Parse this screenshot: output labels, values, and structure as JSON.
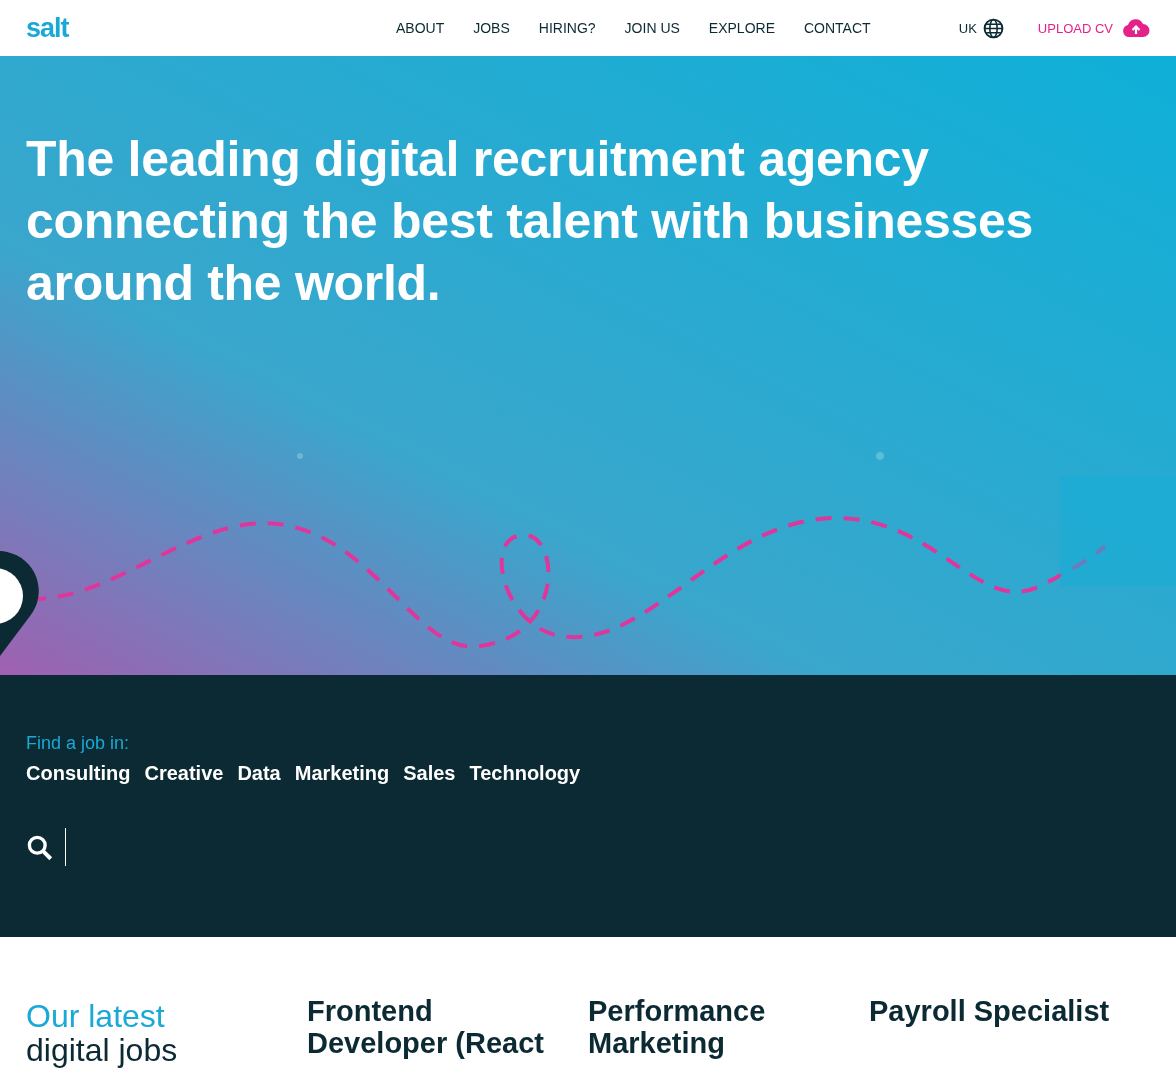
{
  "header": {
    "logo": "salt",
    "nav": [
      {
        "label": "ABOUT"
      },
      {
        "label": "JOBS"
      },
      {
        "label": "HIRING?"
      },
      {
        "label": "JOIN US"
      },
      {
        "label": "EXPLORE"
      },
      {
        "label": "CONTACT"
      }
    ],
    "region": "UK",
    "upload": "UPLOAD CV"
  },
  "hero": {
    "headline": "The leading digital recruitment agency connecting the best talent with businesses around the world."
  },
  "search_section": {
    "label": "Find a job in:",
    "categories": [
      "Consulting",
      "Creative",
      "Data",
      "Marketing",
      "Sales",
      "Technology"
    ]
  },
  "latest": {
    "heading": "Our latest",
    "heading_line_2": "digital jobs",
    "jobs": [
      {
        "title": "Frontend Developer (React"
      },
      {
        "title": "Performance Marketing"
      },
      {
        "title": "Payroll Specialist"
      }
    ]
  }
}
